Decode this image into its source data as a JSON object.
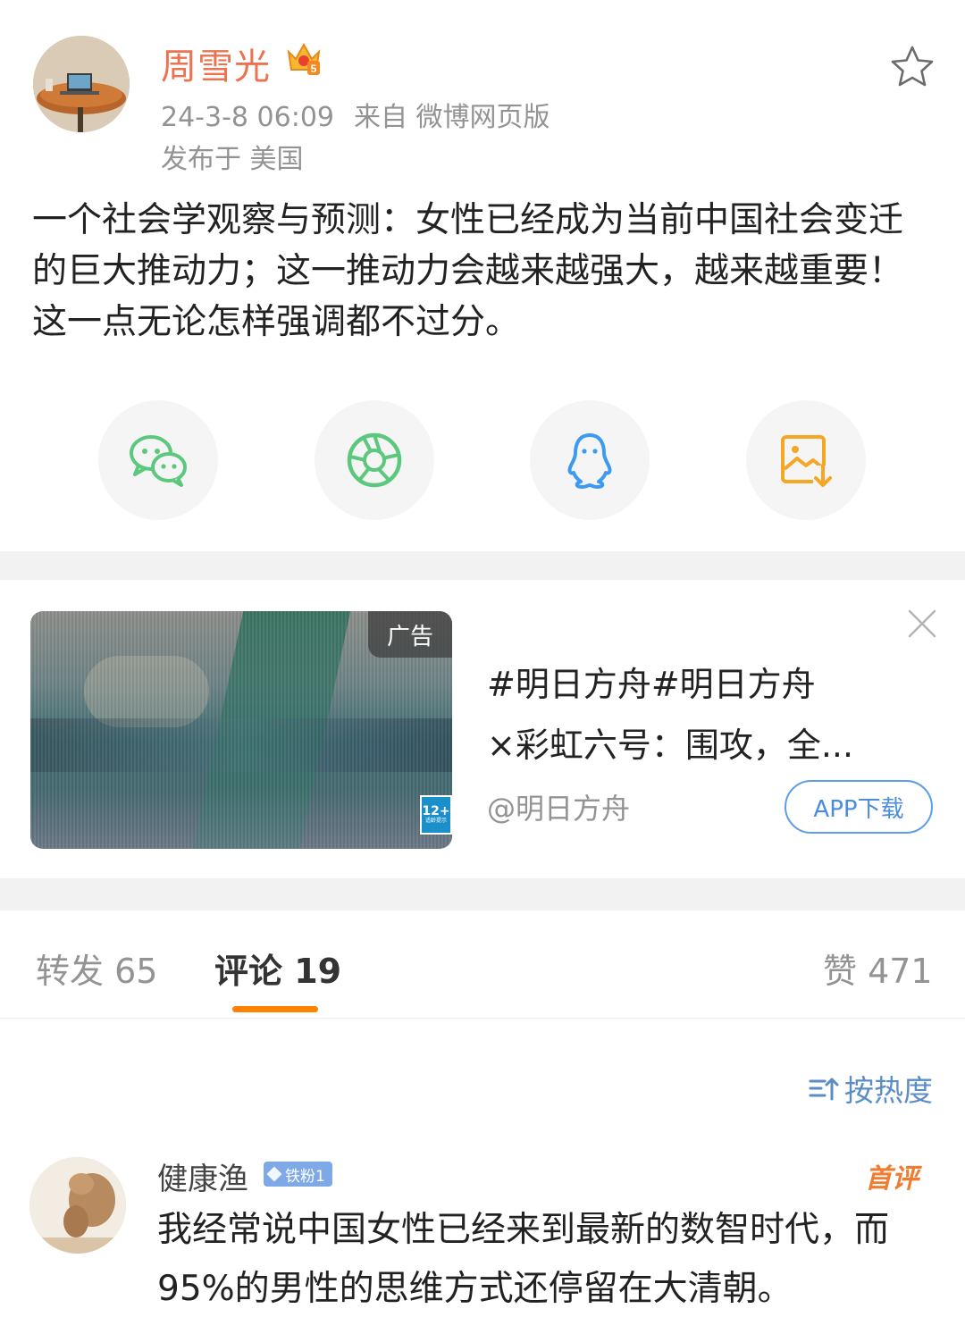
{
  "post": {
    "author": "周雪光",
    "time": "24-3-8 06:09",
    "source": "来自 微博网页版",
    "location": "发布于 美国",
    "content": "一个社会学观察与预测：女性已经成为当前中国社会变迁的巨大推动力；这一推动力会越来越强大，越来越重要！这一点无论怎样强调都不过分。",
    "badge_level": "5"
  },
  "share": {
    "items": [
      {
        "icon": "wechat-icon"
      },
      {
        "icon": "moments-icon"
      },
      {
        "icon": "qq-icon"
      },
      {
        "icon": "save-image-icon"
      }
    ]
  },
  "ad": {
    "tag": "广告",
    "age_rating": "12+",
    "age_rating_sub": "适龄提示",
    "title_line1": "#明日方舟#明日方舟",
    "title_line2": "×彩虹六号：围攻，全...",
    "account": "@明日方舟",
    "button": "APP下载"
  },
  "tabs": {
    "repost": "转发 65",
    "comments": "评论 19",
    "likes": "赞 471"
  },
  "sort": {
    "label": "按热度"
  },
  "comments": [
    {
      "user": "健康渔",
      "badge": "铁粉1",
      "tag": "首评",
      "text": "我经常说中国女性已经来到最新的数智时代，而95%的男性的思维方式还停留在大清朝。"
    }
  ],
  "colors": {
    "author": "#eb7350",
    "accent": "#ff8200",
    "link": "#5a8cc5",
    "wechat": "#5bc87e",
    "moments": "#5bc87e",
    "qq": "#3c9bf0",
    "save": "#f5a623"
  }
}
